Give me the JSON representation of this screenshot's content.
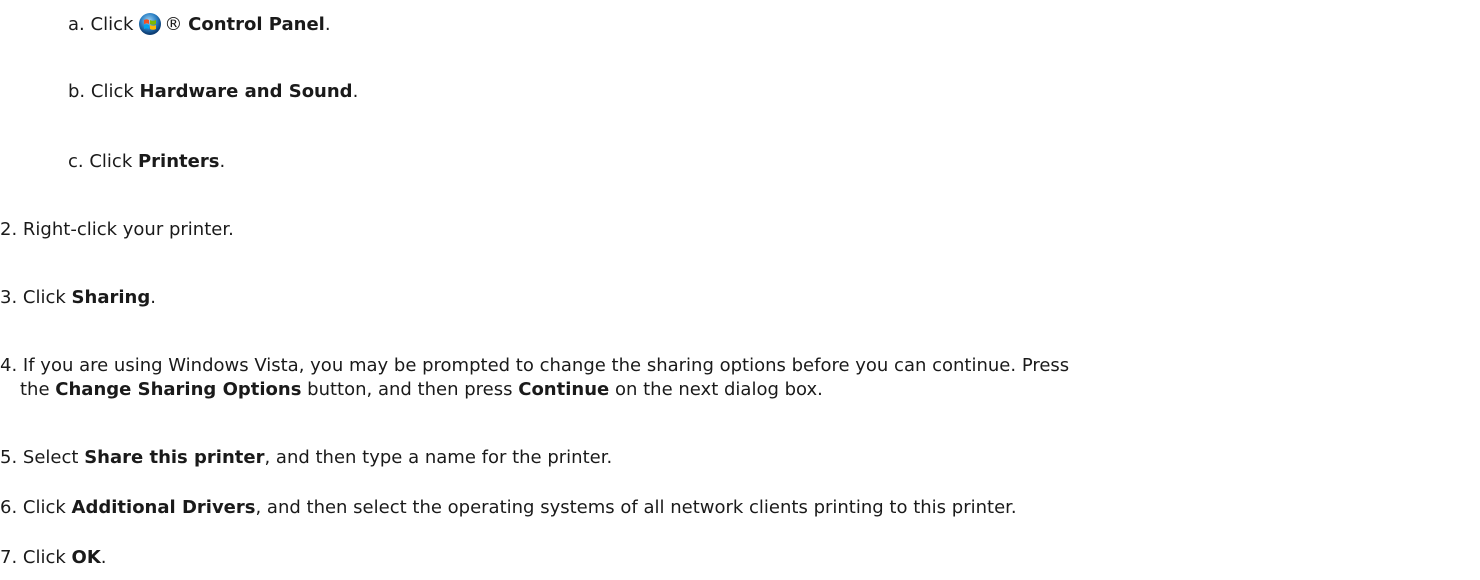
{
  "steps": {
    "a": {
      "marker": "a.",
      "pre": "Click",
      "reg": "®",
      "bold": "Control Panel",
      "post": "."
    },
    "b": {
      "marker": "b.",
      "pre": "Click",
      "bold": "Hardware and Sound",
      "post": "."
    },
    "c": {
      "marker": "c.",
      "pre": "Click",
      "bold": "Printers",
      "post": "."
    },
    "s2": {
      "marker": "2.",
      "text": "Right-click your printer."
    },
    "s3": {
      "marker": "3.",
      "pre": "Click",
      "bold": "Sharing",
      "post": "."
    },
    "s4": {
      "marker": "4.",
      "line1": "If you are using Windows Vista, you may be prompted to change the sharing options before you can continue. Press",
      "pre": "the",
      "bold1": "Change Sharing Options",
      "mid": "button, and then press",
      "bold2": "Continue",
      "post": "on the next dialog box."
    },
    "s5": {
      "marker": "5.",
      "pre": "Select",
      "bold": "Share this printer",
      "post": ", and then type a name for the printer."
    },
    "s6": {
      "marker": "6.",
      "pre": "Click",
      "bold": "Additional Drivers",
      "post": ", and then select the operating systems of all network clients printing to this printer."
    },
    "s7": {
      "marker": "7.",
      "pre": "Click",
      "bold": "OK",
      "post": "."
    }
  },
  "icons": {
    "windows_start": "windows-start-orb-icon"
  }
}
